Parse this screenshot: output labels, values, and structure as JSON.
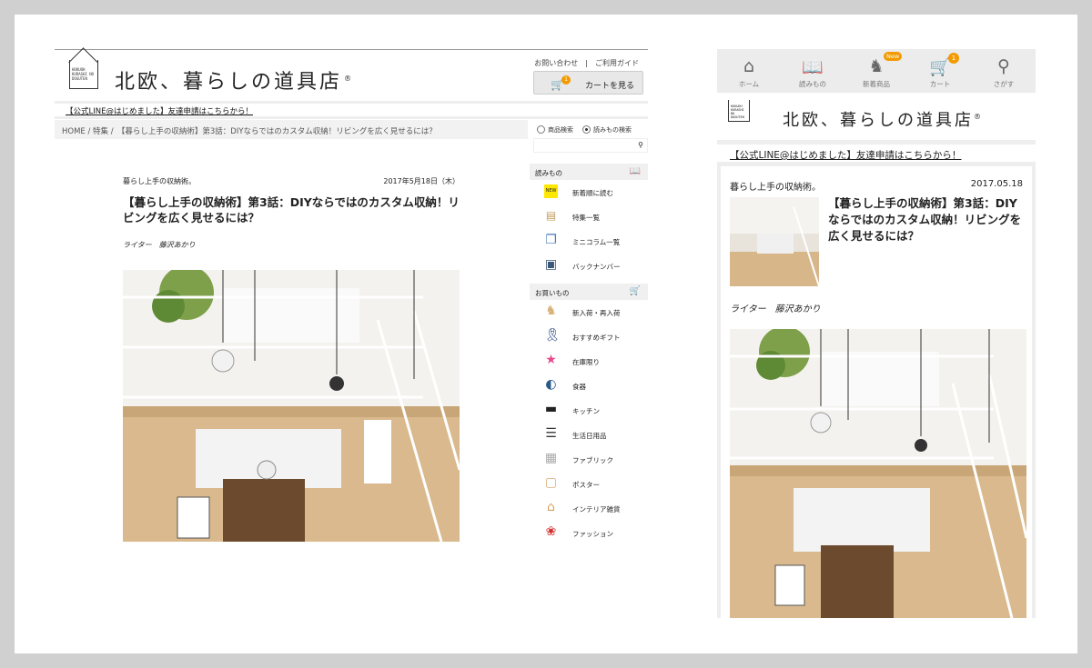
{
  "desktop": {
    "site_title": "北欧、暮らしの道具店",
    "registered": "®",
    "logo_text": "HOKUOH KURASHI NO DOGUTEN",
    "top_links": "お問い合わせ　|　ご利用ガイド",
    "cart_count": "1",
    "cart_label": "カートを見る",
    "line_link": "【公式LINE@はじめました】友達申請はこちらから！",
    "breadcrumb": "HOME / 特集 /　【暮らし上手の収納術】第3話：DIYならではのカスタム収納！リビングを広く見せるには？",
    "search_options": [
      "商品検索",
      "読みもの検索"
    ],
    "article": {
      "category": "暮らし上手の収納術。",
      "date": "2017年5月18日（木）",
      "title": "【暮らし上手の収納術】第3話：DIYならではのカスタム収納！リビングを広く見せるには？",
      "writer": "ライター　藤沢あかり"
    },
    "sidebar": {
      "reading_heading": "読みもの",
      "reading_items": [
        {
          "label": "新着順に読む",
          "icon": "new-badge-icon"
        },
        {
          "label": "特集一覧",
          "icon": "book-icon"
        },
        {
          "label": "ミニコラム一覧",
          "icon": "documents-icon"
        },
        {
          "label": "バックナンバー",
          "icon": "archive-box-icon"
        }
      ],
      "shopping_heading": "お買いもの",
      "shopping_items": [
        {
          "label": "新入荷・再入荷",
          "icon": "horse-icon"
        },
        {
          "label": "おすすめギフト",
          "icon": "ribbon-icon"
        },
        {
          "label": "在庫限り",
          "icon": "star-icon"
        },
        {
          "label": "食器",
          "icon": "tableware-icon"
        },
        {
          "label": "キッチン",
          "icon": "pot-icon"
        },
        {
          "label": "生活日用品",
          "icon": "daily-goods-icon"
        },
        {
          "label": "ファブリック",
          "icon": "fabric-icon"
        },
        {
          "label": "ポスター",
          "icon": "poster-icon"
        },
        {
          "label": "インテリア雑貨",
          "icon": "interior-icon"
        },
        {
          "label": "ファッション",
          "icon": "fashion-icon"
        }
      ]
    }
  },
  "mobile": {
    "nav": [
      {
        "label": "ホーム",
        "icon": "home-icon"
      },
      {
        "label": "読みもの",
        "icon": "book-icon"
      },
      {
        "label": "新着商品",
        "icon": "horse-icon",
        "badge": "New"
      },
      {
        "label": "カート",
        "icon": "cart-icon",
        "badge": "1"
      },
      {
        "label": "さがす",
        "icon": "search-icon"
      }
    ],
    "site_title": "北欧、暮らしの道具店",
    "registered": "®",
    "line_link": "【公式LINE@はじめました】友達申請はこちらから！",
    "article": {
      "category": "暮らし上手の収納術。",
      "date": "2017.05.18",
      "title": "【暮らし上手の収納術】第3話：DIYならではのカスタム収納！リビングを広く見せるには？",
      "writer": "ライター　藤沢あかり"
    }
  },
  "colors": {
    "accent": "#f29a00",
    "background": "#d0d0d0",
    "panel": "#eeeeee"
  }
}
